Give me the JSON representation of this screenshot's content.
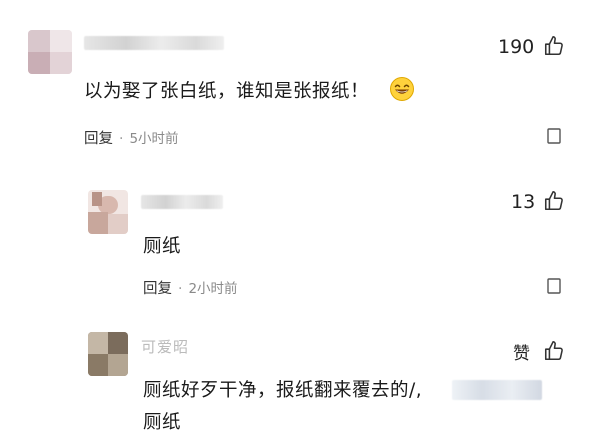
{
  "comments": [
    {
      "likes": "190",
      "text": "以为娶了张白纸，谁知是张报纸！",
      "emoji": "laughing-emoji",
      "reply_label": "回复",
      "time": "5小时前"
    },
    {
      "likes": "13",
      "text": "厕纸",
      "reply_label": "回复",
      "time": "2小时前"
    },
    {
      "name_partial": "可爱昭",
      "likes": "赞",
      "text_line1": "厕纸好歹干净，报纸翻来覆去的/,",
      "text_line2": "厕纸"
    }
  ],
  "icons": {
    "like": "thumbs-up-icon",
    "more": "more-icon"
  },
  "colors": {
    "text": "#1a1a1a",
    "secondary": "#8a8a8a",
    "icon": "#333333"
  }
}
